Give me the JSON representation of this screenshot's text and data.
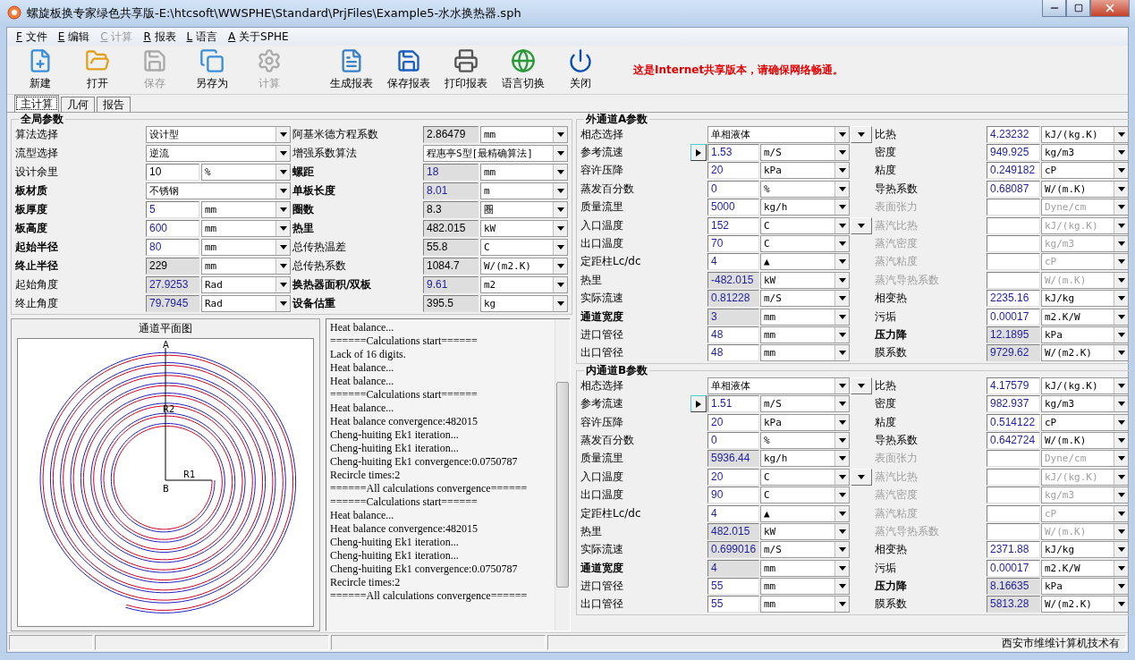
{
  "window": {
    "title": "螺旋板换专家绿色共享版-E:\\htcsoft\\WWSPHE\\Standard\\PrjFiles\\Example5-水水换热器.sph"
  },
  "menu": [
    {
      "key": "F",
      "label": "文件",
      "disabled": false
    },
    {
      "key": "E",
      "label": "编辑",
      "disabled": false
    },
    {
      "key": "C",
      "label": "计算",
      "disabled": true
    },
    {
      "key": "R",
      "label": "报表",
      "disabled": false
    },
    {
      "key": "L",
      "label": "语言",
      "disabled": false
    },
    {
      "key": "A",
      "label": "关于SPHE",
      "disabled": false
    }
  ],
  "toolbar": {
    "groups": [
      [
        {
          "label": "新建",
          "disabled": false
        },
        {
          "label": "打开",
          "disabled": false
        },
        {
          "label": "保存",
          "disabled": true
        },
        {
          "label": "另存为",
          "disabled": false
        },
        {
          "label": "计算",
          "disabled": true
        }
      ],
      [
        {
          "label": "生成报表",
          "disabled": false
        },
        {
          "label": "保存报表",
          "disabled": false
        },
        {
          "label": "打印报表",
          "disabled": false
        },
        {
          "label": "语言切换",
          "disabled": false
        },
        {
          "label": "关闭",
          "disabled": false
        }
      ]
    ],
    "notice": "这是Internet共享版本，请确保网络畅通。"
  },
  "tabs": [
    {
      "label": "主计算",
      "selected": true
    },
    {
      "label": "几何",
      "selected": false
    },
    {
      "label": "报告",
      "selected": false
    }
  ],
  "global": {
    "title": "全局参数",
    "rows": [
      {
        "left": {
          "label": "算法选择",
          "emphasis": false,
          "kind": "select",
          "value": "设计型"
        },
        "right": {
          "label": "阿基米德方程系数",
          "emphasis": false,
          "kind": "value",
          "value": "2.86479",
          "unit": "mm",
          "editable": false,
          "highlighted": false
        }
      },
      {
        "left": {
          "label": "流型选择",
          "emphasis": false,
          "kind": "select",
          "value": "逆流"
        },
        "right": {
          "label": "增强系数算法",
          "emphasis": false,
          "kind": "select",
          "value": "程惠亭S型[最精确算法]"
        }
      },
      {
        "left": {
          "label": "设计余里",
          "emphasis": false,
          "kind": "value",
          "value": "10",
          "unit": "%",
          "editable": true,
          "highlighted": false
        },
        "right": {
          "label": "螺距",
          "emphasis": true,
          "kind": "value",
          "value": "18",
          "unit": "mm",
          "editable": false,
          "highlighted": true
        }
      },
      {
        "left": {
          "label": "板材质",
          "emphasis": true,
          "kind": "select",
          "value": "不锈钢"
        },
        "right": {
          "label": "单板长度",
          "emphasis": true,
          "kind": "value",
          "value": "8.01",
          "unit": "m",
          "editable": false,
          "highlighted": true
        }
      },
      {
        "left": {
          "label": "板厚度",
          "emphasis": true,
          "kind": "value",
          "value": "5",
          "unit": "mm",
          "editable": true,
          "highlighted": true
        },
        "right": {
          "label": "圈数",
          "emphasis": true,
          "kind": "value",
          "value": "8.3",
          "unit": "圈",
          "editable": false,
          "highlighted": false
        }
      },
      {
        "left": {
          "label": "板高度",
          "emphasis": true,
          "kind": "value",
          "value": "600",
          "unit": "mm",
          "editable": true,
          "highlighted": true
        },
        "right": {
          "label": "热里",
          "emphasis": true,
          "kind": "value",
          "value": "482.015",
          "unit": "kW",
          "editable": false,
          "highlighted": false
        }
      },
      {
        "left": {
          "label": "起始半径",
          "emphasis": true,
          "kind": "value",
          "value": "80",
          "unit": "mm",
          "editable": true,
          "highlighted": true
        },
        "right": {
          "label": "总传热温差",
          "emphasis": false,
          "kind": "value",
          "value": "55.8",
          "unit": "C",
          "editable": false,
          "highlighted": false
        }
      },
      {
        "left": {
          "label": "终止半径",
          "emphasis": true,
          "kind": "value",
          "value": "229",
          "unit": "mm",
          "editable": false,
          "highlighted": false
        },
        "right": {
          "label": "总传热系数",
          "emphasis": false,
          "kind": "value",
          "value": "1084.7",
          "unit": "W/(m2.K)",
          "editable": false,
          "highlighted": false
        }
      },
      {
        "left": {
          "label": "起始角度",
          "emphasis": false,
          "kind": "value",
          "value": "27.9253",
          "unit": "Rad",
          "editable": false,
          "highlighted": true
        },
        "right": {
          "label": "换热器面积/双板",
          "emphasis": true,
          "kind": "value",
          "value": "9.61",
          "unit": "m2",
          "editable": false,
          "highlighted": true
        }
      },
      {
        "left": {
          "label": "终止角度",
          "emphasis": false,
          "kind": "value",
          "value": "79.7945",
          "unit": "Rad",
          "editable": false,
          "highlighted": true
        },
        "right": {
          "label": "设备估重",
          "emphasis": true,
          "kind": "value",
          "value": "395.5",
          "unit": "kg",
          "editable": false,
          "highlighted": false
        }
      }
    ]
  },
  "plan_view": {
    "title": "通道平面图",
    "labels": {
      "top": "A",
      "center": "B",
      "inner_radius": "R1",
      "outer_radius": "R2"
    }
  },
  "log": [
    "Heat balance...",
    "======Calculations start======",
    "Lack of 16 digits.",
    "Heat balance...",
    "Heat balance...",
    "======Calculations start======",
    "Heat balance...",
    "Heat balance convergence:482015",
    "Cheng-huiting Ek1 iteration...",
    "Cheng-huiting Ek1 iteration...",
    "Cheng-huiting Ek1 convergence:0.0750787",
    "Recircle times:2",
    "======All calculations convergence======",
    "======Calculations start======",
    "Heat balance...",
    "Heat balance convergence:482015",
    "Cheng-huiting Ek1 iteration...",
    "Cheng-huiting Ek1 iteration...",
    "Cheng-huiting Ek1 convergence:0.0750787",
    "Recircle times:2",
    "======All calculations convergence======"
  ],
  "channels": [
    {
      "title": "外通道A参数",
      "rows": [
        {
          "left": {
            "label": "相态选择",
            "emphasis": false,
            "kind": "select",
            "value": "单相液体"
          },
          "right": {
            "label": "比热",
            "emphasis": false,
            "disabled": false,
            "dropdown_button": true,
            "value": "4.23232",
            "unit": "kJ/(kg.K)",
            "editable": true,
            "highlighted": true
          }
        },
        {
          "left": {
            "label": "参考流速",
            "emphasis": false,
            "kind": "button_value",
            "value": "1.53",
            "unit": "m/S",
            "editable": true,
            "highlighted": true
          },
          "right": {
            "label": "密度",
            "emphasis": false,
            "disabled": false,
            "dropdown_button": false,
            "value": "949.925",
            "unit": "kg/m3",
            "editable": true,
            "highlighted": true
          }
        },
        {
          "left": {
            "label": "容许压降",
            "emphasis": false,
            "kind": "value",
            "value": "20",
            "unit": "kPa",
            "editable": true,
            "highlighted": true
          },
          "right": {
            "label": "粘度",
            "emphasis": false,
            "disabled": false,
            "dropdown_button": false,
            "value": "0.249182",
            "unit": "cP",
            "editable": true,
            "highlighted": true
          }
        },
        {
          "left": {
            "label": "蒸发百分数",
            "emphasis": false,
            "kind": "value",
            "value": "0",
            "unit": "%",
            "editable": true,
            "highlighted": true
          },
          "right": {
            "label": "导热系数",
            "emphasis": false,
            "disabled": false,
            "dropdown_button": false,
            "value": "0.68087",
            "unit": "W/(m.K)",
            "editable": true,
            "highlighted": true
          }
        },
        {
          "left": {
            "label": "质量流里",
            "emphasis": false,
            "kind": "value",
            "value": "5000",
            "unit": "kg/h",
            "editable": true,
            "highlighted": true
          },
          "right": {
            "label": "表面张力",
            "emphasis": false,
            "disabled": true,
            "dropdown_button": false,
            "unit": "Dyne/cm",
            "editable": true,
            "highlighted": true
          }
        },
        {
          "left": {
            "label": "入口温度",
            "emphasis": false,
            "kind": "value",
            "value": "152",
            "unit": "C",
            "editable": true,
            "highlighted": true
          },
          "right": {
            "label": "蒸汽比热",
            "emphasis": false,
            "disabled": true,
            "dropdown_button": true,
            "unit": "kJ/(kg.K)",
            "editable": true,
            "highlighted": true
          }
        },
        {
          "left": {
            "label": "出口温度",
            "emphasis": false,
            "kind": "value",
            "value": "70",
            "unit": "C",
            "editable": true,
            "highlighted": true
          },
          "right": {
            "label": "蒸汽密度",
            "emphasis": false,
            "disabled": true,
            "dropdown_button": false,
            "unit": "kg/m3",
            "editable": true,
            "highlighted": true
          }
        },
        {
          "left": {
            "label": "定距柱Lc/dc",
            "emphasis": false,
            "kind": "value",
            "value": "4",
            "unit": "▲",
            "editable": true,
            "highlighted": true
          },
          "right": {
            "label": "蒸汽粘度",
            "emphasis": false,
            "disabled": true,
            "dropdown_button": false,
            "unit": "cP",
            "editable": true,
            "highlighted": true
          }
        },
        {
          "left": {
            "label": "热里",
            "emphasis": false,
            "kind": "value",
            "value": "-482.015",
            "unit": "kW",
            "editable": false,
            "highlighted": true
          },
          "right": {
            "label": "蒸汽导热系数",
            "emphasis": false,
            "disabled": true,
            "dropdown_button": false,
            "unit": "W/(m.K)",
            "editable": true,
            "highlighted": true
          }
        },
        {
          "left": {
            "label": "实际流速",
            "emphasis": false,
            "kind": "value",
            "value": "0.81228",
            "unit": "m/S",
            "editable": false,
            "highlighted": true
          },
          "right": {
            "label": "相变热",
            "emphasis": false,
            "disabled": false,
            "dropdown_button": false,
            "value": "2235.16",
            "unit": "kJ/kg",
            "editable": true,
            "highlighted": true
          }
        },
        {
          "left": {
            "label": "通道宽度",
            "emphasis": true,
            "kind": "value",
            "value": "3",
            "unit": "mm",
            "editable": false,
            "highlighted": true
          },
          "right": {
            "label": "污垢",
            "emphasis": false,
            "disabled": false,
            "dropdown_button": false,
            "value": "0.00017",
            "unit": "m2.K/W",
            "editable": true,
            "highlighted": true
          }
        },
        {
          "left": {
            "label": "进口管径",
            "emphasis": false,
            "kind": "value",
            "value": "48",
            "unit": "mm",
            "editable": true,
            "highlighted": true
          },
          "right": {
            "label": "压力降",
            "emphasis": true,
            "disabled": false,
            "dropdown_button": false,
            "value": "12.1895",
            "unit": "kPa",
            "editable": false,
            "highlighted": true
          }
        },
        {
          "left": {
            "label": "出口管径",
            "emphasis": false,
            "kind": "value",
            "value": "48",
            "unit": "mm",
            "editable": true,
            "highlighted": true
          },
          "right": {
            "label": "膜系数",
            "emphasis": false,
            "disabled": false,
            "dropdown_button": false,
            "value": "9729.62",
            "unit": "W/(m2.K)",
            "editable": false,
            "highlighted": true
          }
        }
      ]
    },
    {
      "title": "内通道B参数",
      "rows": [
        {
          "left": {
            "label": "相态选择",
            "emphasis": false,
            "kind": "select",
            "value": "单相液体"
          },
          "right": {
            "label": "比热",
            "emphasis": false,
            "disabled": false,
            "dropdown_button": true,
            "value": "4.17579",
            "unit": "kJ/(kg.K)",
            "editable": true,
            "highlighted": true
          }
        },
        {
          "left": {
            "label": "参考流速",
            "emphasis": false,
            "kind": "button_value",
            "value": "1.51",
            "unit": "m/S",
            "editable": true,
            "highlighted": true
          },
          "right": {
            "label": "密度",
            "emphasis": false,
            "disabled": false,
            "dropdown_button": false,
            "value": "982.937",
            "unit": "kg/m3",
            "editable": true,
            "highlighted": true
          }
        },
        {
          "left": {
            "label": "容许压降",
            "emphasis": false,
            "kind": "value",
            "value": "20",
            "unit": "kPa",
            "editable": true,
            "highlighted": true
          },
          "right": {
            "label": "粘度",
            "emphasis": false,
            "disabled": false,
            "dropdown_button": false,
            "value": "0.514122",
            "unit": "cP",
            "editable": true,
            "highlighted": true
          }
        },
        {
          "left": {
            "label": "蒸发百分数",
            "emphasis": false,
            "kind": "value",
            "value": "0",
            "unit": "%",
            "editable": true,
            "highlighted": true
          },
          "right": {
            "label": "导热系数",
            "emphasis": false,
            "disabled": false,
            "dropdown_button": false,
            "value": "0.642724",
            "unit": "W/(m.K)",
            "editable": true,
            "highlighted": true
          }
        },
        {
          "left": {
            "label": "质量流里",
            "emphasis": false,
            "kind": "value",
            "value": "5936.44",
            "unit": "kg/h",
            "editable": false,
            "highlighted": true
          },
          "right": {
            "label": "表面张力",
            "emphasis": false,
            "disabled": true,
            "dropdown_button": false,
            "unit": "Dyne/cm",
            "editable": true,
            "highlighted": true
          }
        },
        {
          "left": {
            "label": "入口温度",
            "emphasis": false,
            "kind": "value",
            "value": "20",
            "unit": "C",
            "editable": true,
            "highlighted": true
          },
          "right": {
            "label": "蒸汽比热",
            "emphasis": false,
            "disabled": true,
            "dropdown_button": true,
            "unit": "kJ/(kg.K)",
            "editable": true,
            "highlighted": true
          }
        },
        {
          "left": {
            "label": "出口温度",
            "emphasis": false,
            "kind": "value",
            "value": "90",
            "unit": "C",
            "editable": true,
            "highlighted": true
          },
          "right": {
            "label": "蒸汽密度",
            "emphasis": false,
            "disabled": true,
            "dropdown_button": false,
            "unit": "kg/m3",
            "editable": true,
            "highlighted": true
          }
        },
        {
          "left": {
            "label": "定距柱Lc/dc",
            "emphasis": false,
            "kind": "value",
            "value": "4",
            "unit": "▲",
            "editable": true,
            "highlighted": true
          },
          "right": {
            "label": "蒸汽粘度",
            "emphasis": false,
            "disabled": true,
            "dropdown_button": false,
            "unit": "cP",
            "editable": true,
            "highlighted": true
          }
        },
        {
          "left": {
            "label": "热里",
            "emphasis": false,
            "kind": "value",
            "value": "482.015",
            "unit": "kW",
            "editable": false,
            "highlighted": true
          },
          "right": {
            "label": "蒸汽导热系数",
            "emphasis": false,
            "disabled": true,
            "dropdown_button": false,
            "unit": "W/(m.K)",
            "editable": true,
            "highlighted": true
          }
        },
        {
          "left": {
            "label": "实际流速",
            "emphasis": false,
            "kind": "value",
            "value": "0.699016",
            "unit": "m/S",
            "editable": false,
            "highlighted": true
          },
          "right": {
            "label": "相变热",
            "emphasis": false,
            "disabled": false,
            "dropdown_button": false,
            "value": "2371.88",
            "unit": "kJ/kg",
            "editable": true,
            "highlighted": true
          }
        },
        {
          "left": {
            "label": "通道宽度",
            "emphasis": true,
            "kind": "value",
            "value": "4",
            "unit": "mm",
            "editable": false,
            "highlighted": true
          },
          "right": {
            "label": "污垢",
            "emphasis": false,
            "disabled": false,
            "dropdown_button": false,
            "value": "0.00017",
            "unit": "m2.K/W",
            "editable": true,
            "highlighted": true
          }
        },
        {
          "left": {
            "label": "进口管径",
            "emphasis": false,
            "kind": "value",
            "value": "55",
            "unit": "mm",
            "editable": true,
            "highlighted": true
          },
          "right": {
            "label": "压力降",
            "emphasis": true,
            "disabled": false,
            "dropdown_button": false,
            "value": "8.16635",
            "unit": "kPa",
            "editable": false,
            "highlighted": true
          }
        },
        {
          "left": {
            "label": "出口管径",
            "emphasis": false,
            "kind": "value",
            "value": "55",
            "unit": "mm",
            "editable": true,
            "highlighted": true
          },
          "right": {
            "label": "膜系数",
            "emphasis": false,
            "disabled": false,
            "dropdown_button": false,
            "value": "5813.28",
            "unit": "W/(m2.K)",
            "editable": false,
            "highlighted": true
          }
        }
      ]
    }
  ],
  "status_bar": {
    "text": "西安市维维计算机技术有"
  }
}
